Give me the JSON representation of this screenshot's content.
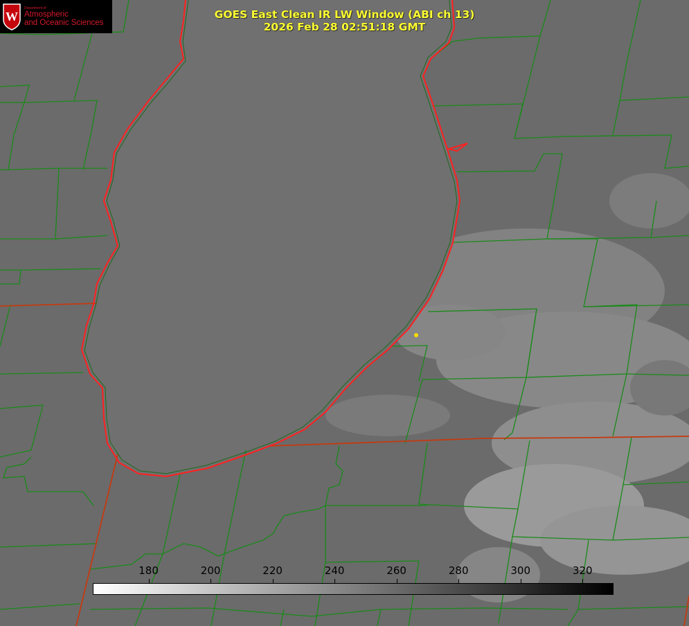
{
  "logo": {
    "department": "Department of",
    "line1": "Atmospheric",
    "line2": "and Oceanic Sciences",
    "crest_letter": "W",
    "crest_color": "#c5050c"
  },
  "title": {
    "line1": "GOES East Clean IR LW Window (ABI ch 13)",
    "line2": "2026 Feb 28 02:51:18 GMT"
  },
  "colorbar": {
    "range": [
      162,
      330
    ],
    "ticks": [
      "180",
      "200",
      "220",
      "240",
      "260",
      "280",
      "300",
      "320"
    ],
    "tick_values": [
      180,
      200,
      220,
      240,
      260,
      280,
      300,
      320
    ],
    "low_color": "#ffffff",
    "high_color": "#000000"
  },
  "map": {
    "background_color": "#6a6a6a",
    "lake_color": "#707070",
    "county_line_color": "#1a8a1a",
    "state_line_color": "#c43a10",
    "coast_line_color": "#ff2020",
    "marker_color": "#ffdd00"
  }
}
